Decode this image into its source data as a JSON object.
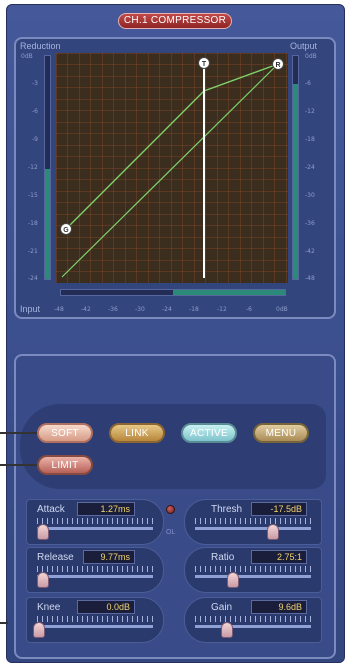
{
  "title": "CH.1 COMPRESSOR",
  "graph": {
    "reduction_label": "Reduction",
    "output_label": "Output",
    "input_label": "Input",
    "left_ticks": [
      "0dB",
      "-3",
      "-6",
      "-9",
      "-12",
      "-15",
      "-18",
      "-21",
      "-24"
    ],
    "right_ticks": [
      "0dB",
      "-6",
      "-12",
      "-18",
      "-24",
      "-30",
      "-36",
      "-42",
      "-48"
    ],
    "bottom_ticks": [
      "-48",
      "-42",
      "-36",
      "-30",
      "-24",
      "-18",
      "-12",
      "-6",
      "0dB"
    ],
    "markers": {
      "threshold": "T",
      "ratio": "R",
      "gain": "G"
    }
  },
  "buttons": {
    "soft": "SOFT",
    "link": "LINK",
    "active": "ACTIVE",
    "menu": "MENU",
    "limit": "LIMIT"
  },
  "controls": {
    "attack": {
      "label": "Attack",
      "value": "1.27ms",
      "level": 0.05
    },
    "release": {
      "label": "Release",
      "value": "9.77ms",
      "level": 0.05
    },
    "knee": {
      "label": "Knee",
      "value": "0.0dB",
      "level": 0.0
    },
    "thresh": {
      "label": "Thresh",
      "value": "-17.5dB",
      "level": 0.63
    },
    "ratio": {
      "label": "Ratio",
      "value": "2.75:1",
      "level": 0.1
    },
    "gain": {
      "label": "Gain",
      "value": "9.6dB",
      "level": 0.12
    }
  },
  "ol_label": "OL",
  "colors": {
    "panel": "#3a4d8c",
    "grid_bg": "#3b2e1f",
    "grid_line": "#8c4a28",
    "curve": "#7fd26a",
    "threshold_line": "#ffffff",
    "value_text": "#f1d470"
  }
}
